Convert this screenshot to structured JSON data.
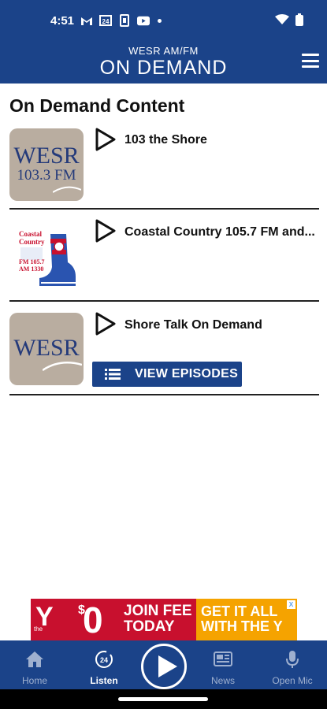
{
  "status_bar": {
    "time": "4:51",
    "icons_left": [
      "gmail-icon",
      "news-badge-icon",
      "sim-icon",
      "youtube-icon",
      "dot-icon"
    ],
    "icons_right": [
      "wifi-icon",
      "battery-icon"
    ]
  },
  "header": {
    "subtitle": "WESR AM/FM",
    "title": "ON DEMAND",
    "menu_icon": "hamburger-menu-icon"
  },
  "page_title": "On Demand Content",
  "items": [
    {
      "title": "103 the Shore",
      "logo_line1": "WESR",
      "logo_line2": "103.3 FM"
    },
    {
      "title": "Coastal Country 105.7 FM and...",
      "logo_line1": "Coastal",
      "logo_line2": "Country",
      "logo_line3": "FM 105.7",
      "logo_line4": "AM 1330"
    },
    {
      "title": "Shore Talk On Demand",
      "logo_line1": "WESR",
      "button_label": "VIEW EPISODES"
    }
  ],
  "ad": {
    "brand": "Y",
    "brand_prefix": "the",
    "dollar": "$",
    "amount": "0",
    "line1": "JOIN FEE",
    "line2": "TODAY",
    "right_line1": "GET IT ALL",
    "right_line2": "WITH THE Y",
    "close": "x"
  },
  "nav": {
    "home": "Home",
    "listen": "Listen",
    "news": "News",
    "open_mic": "Open Mic",
    "listen_badge": "24"
  },
  "colors": {
    "primary": "#1b4389",
    "ad_red": "#c8102e",
    "ad_orange": "#f5a300"
  }
}
